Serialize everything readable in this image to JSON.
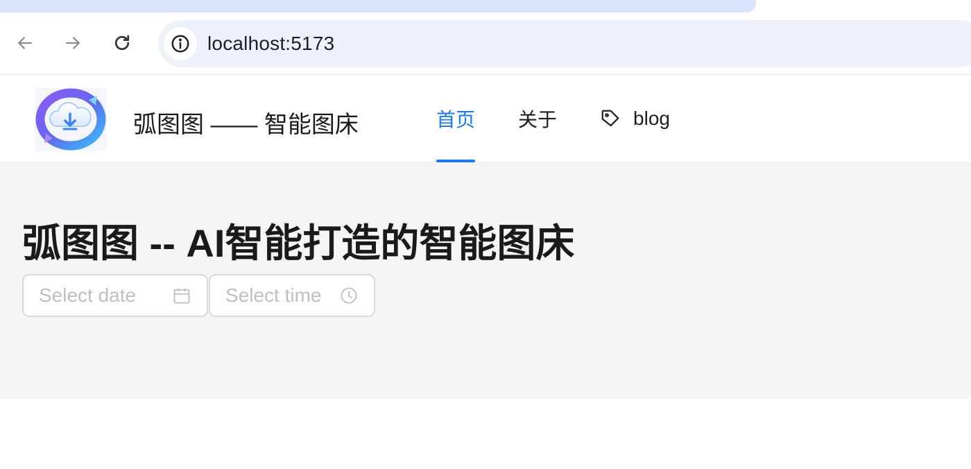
{
  "browser": {
    "url": "localhost:5173",
    "tab_color": "#d8e4fb",
    "omnibox_color": "#edf2fa"
  },
  "header": {
    "logo_icon": "cloud-download-logo",
    "title": "弧图图 —— 智能图床",
    "menu": [
      {
        "label": "首页",
        "active": true,
        "icon": null
      },
      {
        "label": "关于",
        "active": false,
        "icon": null
      },
      {
        "label": "blog",
        "active": false,
        "icon": "tag-icon"
      }
    ],
    "accent": "#1677ff"
  },
  "main": {
    "title": "弧图图 -- AI智能打造的智能图床",
    "date_picker": {
      "placeholder": "Select date",
      "icon": "calendar-icon"
    },
    "time_picker": {
      "placeholder": "Select time",
      "icon": "clock-icon"
    },
    "background": "#f5f5f5"
  }
}
